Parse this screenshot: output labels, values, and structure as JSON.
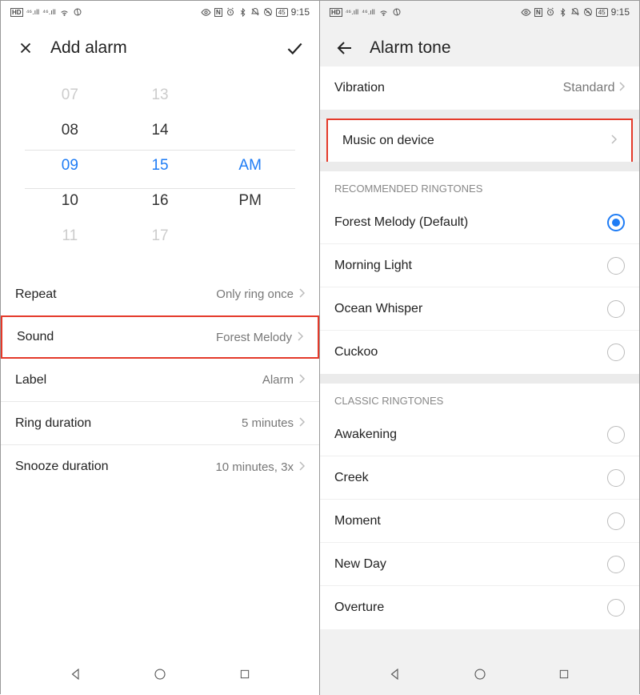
{
  "status": {
    "left_text": "HD",
    "sup": "46",
    "time": "9:15",
    "battery": "45"
  },
  "left": {
    "title": "Add alarm",
    "picker": {
      "hours": [
        "07",
        "08",
        "09",
        "10",
        "11"
      ],
      "minutes": [
        "13",
        "14",
        "15",
        "16",
        "17"
      ],
      "ampm": [
        "",
        "",
        "AM",
        "PM",
        ""
      ],
      "selected_idx": 2
    },
    "rows": {
      "repeat_label": "Repeat",
      "repeat_value": "Only ring once",
      "sound_label": "Sound",
      "sound_value": "Forest Melody",
      "label_label": "Label",
      "label_value": "Alarm",
      "ring_label": "Ring duration",
      "ring_value": "5 minutes",
      "snooze_label": "Snooze duration",
      "snooze_value": "10 minutes, 3x"
    }
  },
  "right": {
    "title": "Alarm tone",
    "vibration_label": "Vibration",
    "vibration_value": "Standard",
    "music_label": "Music on device",
    "recommended_header": "RECOMMENDED RINGTONES",
    "recommended": [
      {
        "label": "Forest Melody (Default)",
        "checked": true
      },
      {
        "label": "Morning Light",
        "checked": false
      },
      {
        "label": "Ocean Whisper",
        "checked": false
      },
      {
        "label": "Cuckoo",
        "checked": false
      }
    ],
    "classic_header": "CLASSIC RINGTONES",
    "classic": [
      {
        "label": "Awakening"
      },
      {
        "label": "Creek"
      },
      {
        "label": "Moment"
      },
      {
        "label": "New Day"
      },
      {
        "label": "Overture"
      }
    ]
  }
}
